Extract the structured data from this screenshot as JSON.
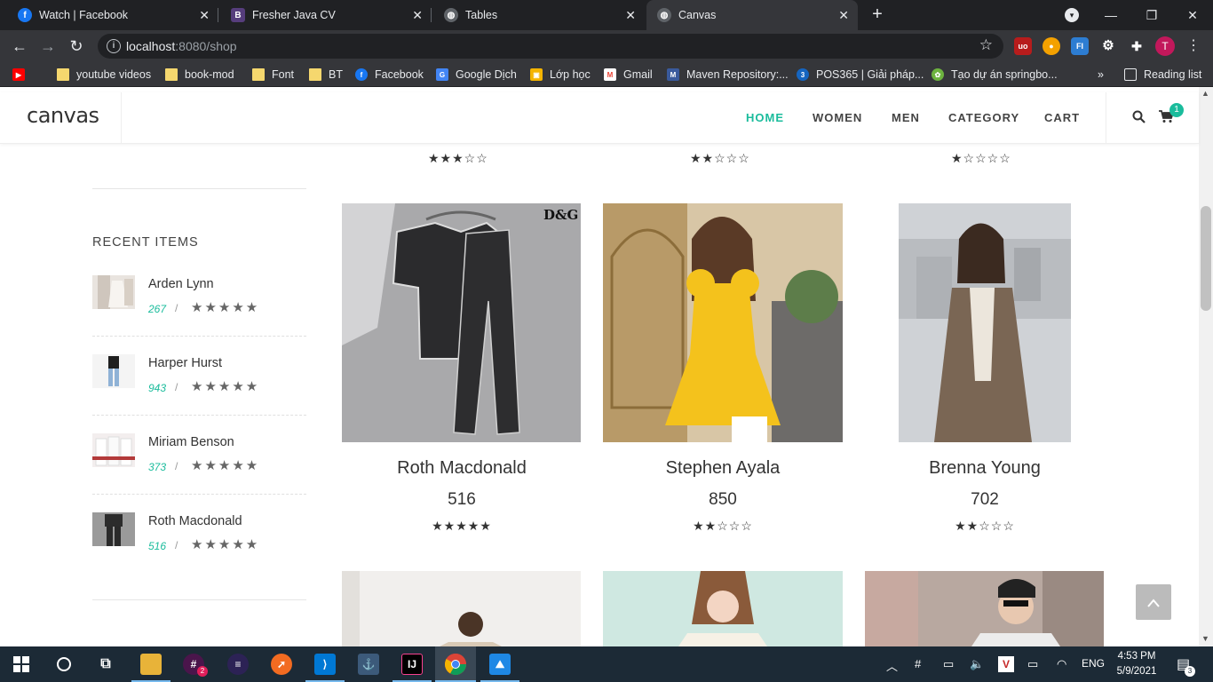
{
  "browser": {
    "tabs": [
      {
        "title": "Watch | Facebook",
        "icon": "facebook-icon"
      },
      {
        "title": "Fresher Java CV",
        "icon": "bootstrap-icon"
      },
      {
        "title": "Tables",
        "icon": "globe-icon"
      },
      {
        "title": "Canvas",
        "icon": "globe-icon"
      }
    ],
    "url_host": "localhost",
    "url_rest": ":8080/shop",
    "profile_initial": "T",
    "bookmarks": [
      {
        "label": "youtube videos"
      },
      {
        "label": "book-mod"
      },
      {
        "label": "Font"
      },
      {
        "label": "BT"
      },
      {
        "label": "Facebook"
      },
      {
        "label": "Google Dịch"
      },
      {
        "label": "Lớp học"
      },
      {
        "label": "Gmail"
      },
      {
        "label": "Maven Repository:..."
      },
      {
        "label": "POS365 | Giải pháp..."
      },
      {
        "label": "Tạo dự án springbo..."
      }
    ],
    "reading_list": "Reading list",
    "more_bookmarks": "»"
  },
  "site": {
    "logo": "canvas",
    "nav": [
      "HOME",
      "WOMEN",
      "MEN",
      "CATEGORY",
      "CART"
    ],
    "cart_count": "1"
  },
  "top_ratings": [
    3,
    2,
    1
  ],
  "sidebar": {
    "title": "RECENT ITEMS",
    "items": [
      {
        "name": "Arden Lynn",
        "price": "267",
        "slash": "/"
      },
      {
        "name": "Harper Hurst",
        "price": "943",
        "slash": "/"
      },
      {
        "name": "Miriam Benson",
        "price": "373",
        "slash": "/"
      },
      {
        "name": "Roth Macdonald",
        "price": "516",
        "slash": "/"
      }
    ]
  },
  "products": [
    {
      "name": "Roth Macdonald",
      "price": "516",
      "rating": 5
    },
    {
      "name": "Stephen Ayala",
      "price": "850",
      "rating": 2
    },
    {
      "name": "Brenna Young",
      "price": "702",
      "rating": 2
    }
  ],
  "taskbar": {
    "time": "4:53 PM",
    "date": "5/9/2021",
    "lang": "ENG",
    "notification_count": "3",
    "slack_badge": "2"
  },
  "colors": {
    "accent": "#1abc9c",
    "chrome_dark": "#202124",
    "taskbar": "#1c2a36"
  }
}
